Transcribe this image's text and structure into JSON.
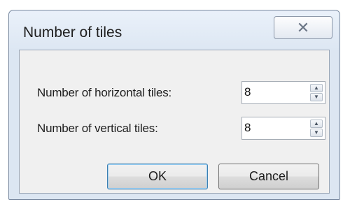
{
  "window": {
    "title": "Number of tiles",
    "close_glyph": "✕"
  },
  "fields": {
    "horizontal": {
      "label": "Number of horizontal tiles:",
      "value": "8"
    },
    "vertical": {
      "label": "Number of vertical tiles:",
      "value": "8"
    }
  },
  "buttons": {
    "ok": "OK",
    "cancel": "Cancel"
  },
  "icons": {
    "spin_up": "spin-up-icon",
    "spin_down": "spin-down-icon",
    "close": "close-icon"
  }
}
